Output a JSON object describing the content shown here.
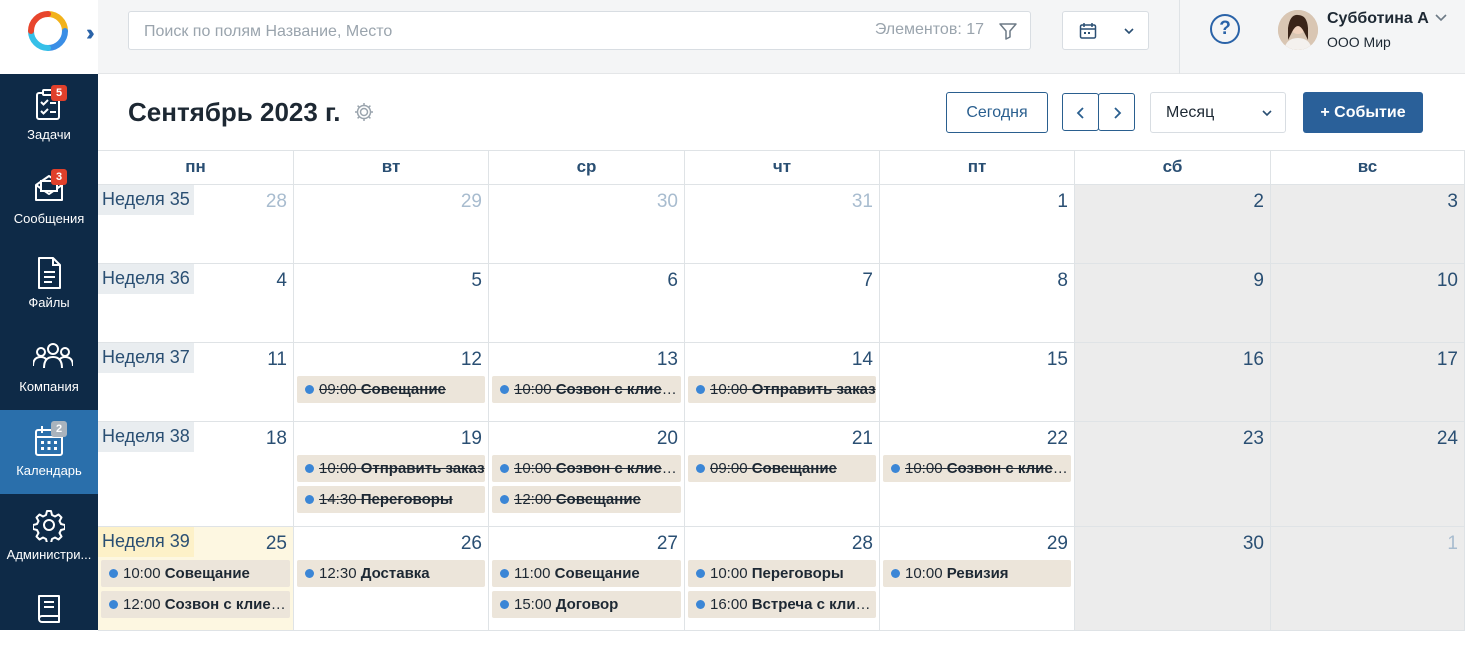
{
  "search": {
    "placeholder": "Поиск по полям Название, Место",
    "count": "Элементов: 17"
  },
  "user": {
    "name": "Субботина А",
    "company": "ООО Мир"
  },
  "sidebar": {
    "items": [
      {
        "label": "Задачи",
        "badge": "5",
        "icon": "tasks-icon"
      },
      {
        "label": "Сообщения",
        "badge": "3",
        "icon": "messages-icon"
      },
      {
        "label": "Файлы",
        "badge": "",
        "icon": "files-icon"
      },
      {
        "label": "Компания",
        "badge": "",
        "icon": "company-icon"
      },
      {
        "label": "Календарь",
        "badge": "2",
        "icon": "calendar-icon",
        "active": true
      },
      {
        "label": "Администри...",
        "badge": "",
        "icon": "admin-gear-icon"
      },
      {
        "label": "",
        "badge": "",
        "icon": "book-icon"
      }
    ]
  },
  "header": {
    "title": "Сентябрь 2023 г.",
    "today_label": "Сегодня",
    "view_label": "Месяц",
    "add_label": "+ Событие"
  },
  "days": [
    "пн",
    "вт",
    "ср",
    "чт",
    "пт",
    "сб",
    "вс"
  ],
  "weeks": [
    {
      "label": "Неделя 35",
      "days": [
        {
          "n": "28",
          "muted": true
        },
        {
          "n": "29",
          "muted": true
        },
        {
          "n": "30",
          "muted": true
        },
        {
          "n": "31",
          "muted": true
        },
        {
          "n": "1"
        },
        {
          "n": "2"
        },
        {
          "n": "3"
        }
      ]
    },
    {
      "label": "Неделя 36",
      "days": [
        {
          "n": "4"
        },
        {
          "n": "5"
        },
        {
          "n": "6"
        },
        {
          "n": "7"
        },
        {
          "n": "8"
        },
        {
          "n": "9"
        },
        {
          "n": "10"
        }
      ]
    },
    {
      "label": "Неделя 37",
      "days": [
        {
          "n": "11"
        },
        {
          "n": "12",
          "events": [
            {
              "time": "09:00",
              "name": "Совещание",
              "done": true
            }
          ]
        },
        {
          "n": "13",
          "events": [
            {
              "time": "10:00",
              "name": "Созвон с клиентом",
              "done": true
            }
          ]
        },
        {
          "n": "14",
          "events": [
            {
              "time": "10:00",
              "name": "Отправить заказ",
              "done": true
            }
          ]
        },
        {
          "n": "15"
        },
        {
          "n": "16"
        },
        {
          "n": "17"
        }
      ]
    },
    {
      "label": "Неделя 38",
      "days": [
        {
          "n": "18"
        },
        {
          "n": "19",
          "events": [
            {
              "time": "10:00",
              "name": "Отправить заказ",
              "done": true
            },
            {
              "time": "14:30",
              "name": "Переговоры",
              "done": true
            }
          ]
        },
        {
          "n": "20",
          "events": [
            {
              "time": "10:00",
              "name": "Созвон с клиентом",
              "done": true
            },
            {
              "time": "12:00",
              "name": "Совещание",
              "done": true
            }
          ]
        },
        {
          "n": "21",
          "events": [
            {
              "time": "09:00",
              "name": "Совещание",
              "done": true
            }
          ]
        },
        {
          "n": "22",
          "events": [
            {
              "time": "10:00",
              "name": "Созвон с клиентом",
              "done": true
            }
          ]
        },
        {
          "n": "23"
        },
        {
          "n": "24"
        }
      ]
    },
    {
      "label": "Неделя 39",
      "today": true,
      "days": [
        {
          "n": "25",
          "today": true,
          "events": [
            {
              "time": "10:00",
              "name": "Совещание"
            },
            {
              "time": "12:00",
              "name": "Созвон с клиентом"
            }
          ]
        },
        {
          "n": "26",
          "events": [
            {
              "time": "12:30",
              "name": "Доставка"
            }
          ]
        },
        {
          "n": "27",
          "events": [
            {
              "time": "11:00",
              "name": "Совещание"
            },
            {
              "time": "15:00",
              "name": "Договор"
            }
          ]
        },
        {
          "n": "28",
          "events": [
            {
              "time": "10:00",
              "name": "Переговоры"
            },
            {
              "time": "16:00",
              "name": "Встреча с клиентом"
            }
          ]
        },
        {
          "n": "29",
          "events": [
            {
              "time": "10:00",
              "name": "Ревизия"
            }
          ]
        },
        {
          "n": "30"
        },
        {
          "n": "1",
          "muted": true
        }
      ]
    }
  ]
}
